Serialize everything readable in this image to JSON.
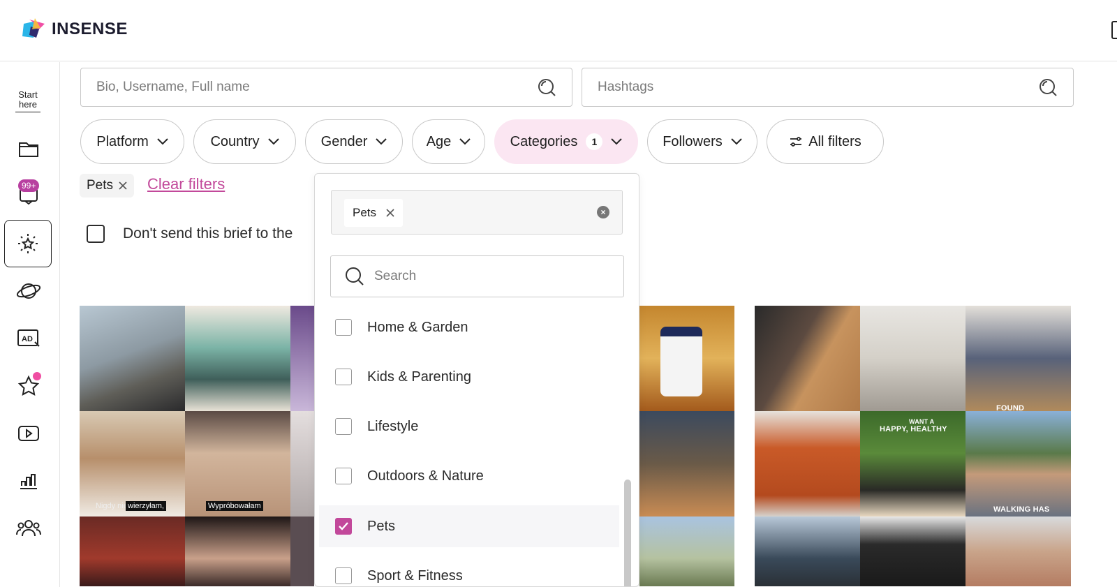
{
  "header": {
    "brand": "INSENSE"
  },
  "sidebar": {
    "start_here": "Start here",
    "messages_badge": "99+"
  },
  "search": {
    "main_placeholder": "Bio, Username, Full name",
    "hashtags_placeholder": "Hashtags"
  },
  "filters": {
    "platform": "Platform",
    "country": "Country",
    "gender": "Gender",
    "age": "Age",
    "categories": "Categories",
    "categories_count": "1",
    "followers": "Followers",
    "all_filters": "All filters"
  },
  "active_chips": {
    "pets": "Pets",
    "clear_filters": "Clear filters"
  },
  "brief_option": {
    "label": "Don't send this brief to the"
  },
  "categories_dropdown": {
    "selected_chip": "Pets",
    "search_placeholder": "Search",
    "options": [
      {
        "label": "Home & Garden",
        "checked": false
      },
      {
        "label": "Kids & Parenting",
        "checked": false
      },
      {
        "label": "Lifestyle",
        "checked": false
      },
      {
        "label": "Outdoors & Nature",
        "checked": false
      },
      {
        "label": "Pets",
        "checked": true
      },
      {
        "label": "Sport & Fitness",
        "checked": false
      }
    ]
  },
  "media": {
    "caption_1": "wierzyłam,",
    "caption_1_prefix": "Nigdy nie",
    "caption_2": "Wypróbowałam",
    "overlay_happy": "HAPPY, HEALTHY",
    "overlay_want": "WANT A",
    "overlay_walking": "WALKING HAS",
    "overlay_found": "FOUND"
  },
  "colors": {
    "accent": "#c2489a",
    "active_pill": "#fbe6f2",
    "badge": "#b83fa0",
    "dot": "#ef4ea2"
  }
}
